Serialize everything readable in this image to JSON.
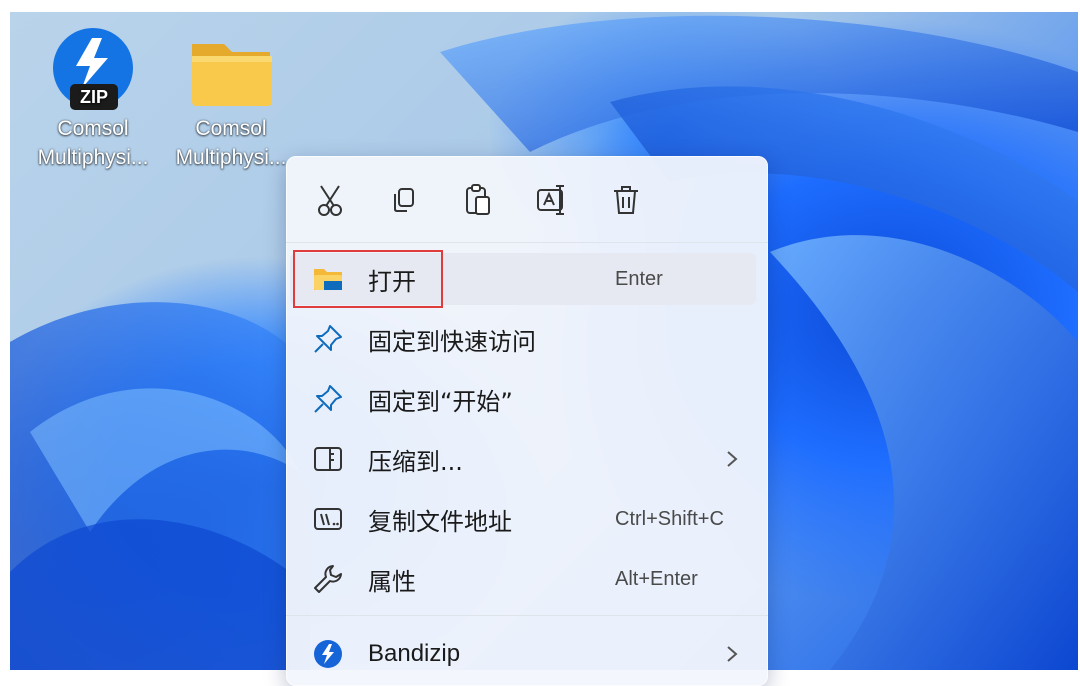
{
  "desktop": {
    "icons": [
      {
        "name_line1": "Comsol",
        "name_line2": "Multiphysi...",
        "icon": "zip-archive-icon",
        "badge": "ZIP"
      },
      {
        "name_line1": "Comsol",
        "name_line2": "Multiphysi...",
        "icon": "folder-icon"
      }
    ]
  },
  "context_menu": {
    "toolbar": [
      {
        "icon": "cut-icon"
      },
      {
        "icon": "copy-icon"
      },
      {
        "icon": "paste-icon"
      },
      {
        "icon": "rename-icon"
      },
      {
        "icon": "delete-icon"
      }
    ],
    "items": [
      {
        "label": "打开",
        "shortcut": "Enter",
        "icon": "folder-open-icon"
      },
      {
        "label": "固定到快速访问",
        "shortcut": "",
        "icon": "pin-icon"
      },
      {
        "label": "固定到“开始”",
        "shortcut": "",
        "icon": "pin-icon"
      },
      {
        "label": "压缩到...",
        "shortcut": "",
        "icon": "archive-icon",
        "submenu": true
      },
      {
        "label": "复制文件地址",
        "shortcut": "Ctrl+Shift+C",
        "icon": "copy-path-icon"
      },
      {
        "label": "属性",
        "shortcut": "Alt+Enter",
        "icon": "wrench-icon"
      },
      {
        "label": "Bandizip",
        "shortcut": "",
        "icon": "bandizip-icon",
        "submenu": true
      }
    ]
  },
  "colors": {
    "highlight_border": "#e03c3c",
    "accent_blue": "#0f6cbd",
    "folder_yellow": "#f8c94b"
  }
}
